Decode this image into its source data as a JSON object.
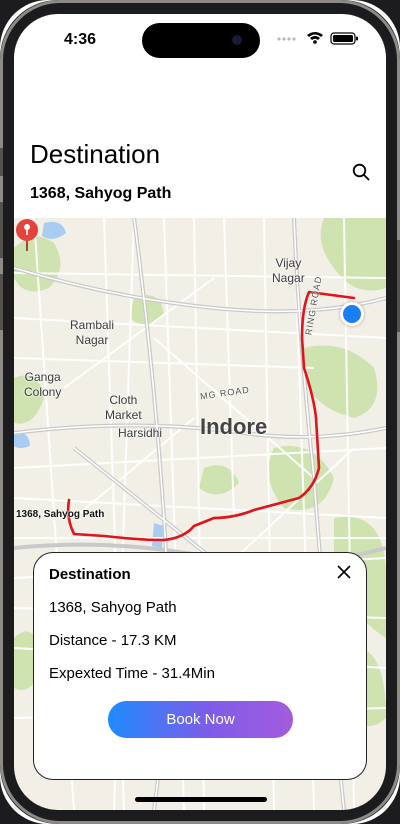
{
  "status_bar": {
    "time": "4:36"
  },
  "header": {
    "title": "Destination",
    "address": "1368, Sahyog Path"
  },
  "icons": {
    "search": "search-icon",
    "close": "close-icon",
    "pin": "map-pin-icon",
    "location": "current-location-icon"
  },
  "map": {
    "labels": {
      "vijay_nagar": "Vijay\nNagar",
      "rambali_nagar": "Rambali\nNagar",
      "ganga_colony": "Ganga\nColony",
      "cloth_market": "Cloth\nMarket",
      "harsidhi": "Harsidhi",
      "indore": "Indore",
      "mg_road": "MG ROAD",
      "ring_road": "RING ROAD"
    },
    "pin_label": "1368, Sahyog Path",
    "route_color": "#e0141c",
    "current_location_color": "#1a7ff2"
  },
  "card": {
    "title": "Destination",
    "address": "1368, Sahyog Path",
    "distance": "Distance - 17.3 KM",
    "time": "Expexted Time - 31.4Min",
    "button_label": "Book Now"
  },
  "colors": {
    "button_gradient_start": "#1f8bff",
    "button_gradient_end": "#a45bdd"
  }
}
